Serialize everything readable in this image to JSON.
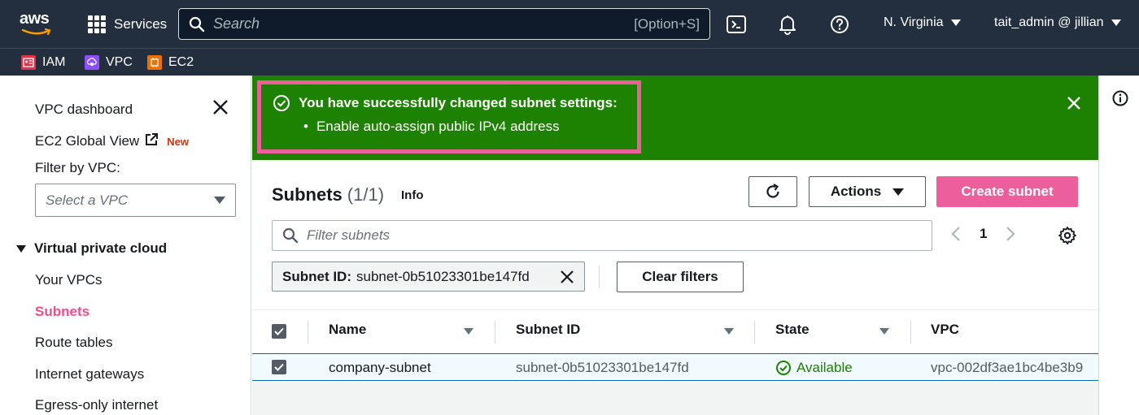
{
  "topnav": {
    "logo_text": "aws",
    "services_label": "Services",
    "search_placeholder": "Search",
    "search_shortcut": "[Option+S]",
    "region": "N. Virginia",
    "user": "tait_admin @ jillian"
  },
  "favorites": [
    {
      "label": "IAM",
      "color": "#dd344c"
    },
    {
      "label": "VPC",
      "color": "#8c4fff"
    },
    {
      "label": "EC2",
      "color": "#ed7100"
    }
  ],
  "sidebar": {
    "dashboard": "VPC dashboard",
    "global_view": "EC2 Global View",
    "new_badge": "New",
    "filter_label": "Filter by VPC:",
    "select_placeholder": "Select a VPC",
    "section": "Virtual private cloud",
    "items": [
      "Your VPCs",
      "Subnets",
      "Route tables",
      "Internet gateways",
      "Egress-only internet"
    ],
    "active_item": "Subnets"
  },
  "flash": {
    "title": "You have successfully changed subnet settings:",
    "item": "Enable auto-assign public IPv4 address"
  },
  "main": {
    "title": "Subnets",
    "count": "(1/1)",
    "info": "Info",
    "actions_label": "Actions",
    "create_label": "Create subnet",
    "filter_placeholder": "Filter subnets",
    "page": "1",
    "token_key": "Subnet ID:",
    "token_value": "subnet-0b51023301be147fd",
    "clear_label": "Clear filters"
  },
  "table": {
    "columns": [
      "Name",
      "Subnet ID",
      "State",
      "VPC"
    ],
    "rows": [
      {
        "name": "company-subnet",
        "subnet_id": "subnet-0b51023301be147fd",
        "state": "Available",
        "vpc": "vpc-002df3ae1bc4be3b9"
      }
    ]
  },
  "colors": {
    "nav_bg": "#232f3e",
    "success_green": "#1d8102",
    "accent_pink": "#ec5e9c",
    "highlight_border": "#ec5e9c"
  }
}
